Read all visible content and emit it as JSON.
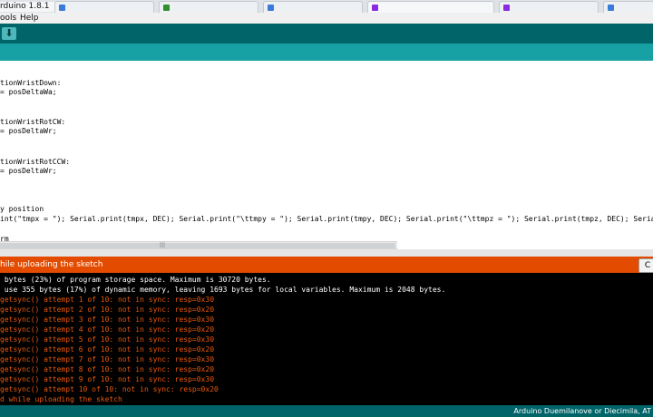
{
  "window": {
    "title": "rduino 1.8.1"
  },
  "menu": [
    "ools",
    "Help"
  ],
  "toolbar": {
    "buttons": [
      {
        "name": "export",
        "glyph": "⬇"
      }
    ]
  },
  "editor": {
    "lines": [
      "tionWristDown:",
      "= posDeltaWa;",
      "",
      "",
      "tionWristRotCW:",
      "= posDeltaWr;",
      "",
      "",
      "tionWristRotCCW:",
      "= posDeltaWr;",
      "",
      "",
      "",
      "y position",
      "int(\"tmpx = \"); Serial.print(tmpx, DEC); Serial.print(\"\\ttmpy = \"); Serial.print(tmpy, DEC); Serial.print(\"\\ttmpz = \"); Serial.print(tmpz, DEC); Serial.print(\"\\ttmp",
      "",
      "rm"
    ]
  },
  "status": {
    "message": "hile uploading the sketch",
    "copy_button": "C"
  },
  "console": {
    "lines": [
      {
        "text": " bytes (23%) of program storage space. Maximum is 30720 bytes.",
        "style": "white"
      },
      {
        "text": " use 355 bytes (17%) of dynamic memory, leaving 1693 bytes for local variables. Maximum is 2048 bytes.",
        "style": "white"
      },
      {
        "text": "getsync() attempt 1 of 10: not in sync: resp=0x30",
        "style": "orange"
      },
      {
        "text": "getsync() attempt 2 of 10: not in sync: resp=0x20",
        "style": "orange"
      },
      {
        "text": "getsync() attempt 3 of 10: not in sync: resp=0x30",
        "style": "orange"
      },
      {
        "text": "getsync() attempt 4 of 10: not in sync: resp=0x20",
        "style": "orange"
      },
      {
        "text": "getsync() attempt 5 of 10: not in sync: resp=0x30",
        "style": "orange"
      },
      {
        "text": "getsync() attempt 6 of 10: not in sync: resp=0x20",
        "style": "orange"
      },
      {
        "text": "getsync() attempt 7 of 10: not in sync: resp=0x30",
        "style": "orange"
      },
      {
        "text": "getsync() attempt 8 of 10: not in sync: resp=0x20",
        "style": "orange"
      },
      {
        "text": "getsync() attempt 9 of 10: not in sync: resp=0x30",
        "style": "orange"
      },
      {
        "text": "getsync() attempt 10 of 10: not in sync: resp=0x20",
        "style": "orange"
      },
      {
        "text": "d while uploading the sketch",
        "style": "orange"
      }
    ]
  },
  "footer": {
    "board": "Arduino Duemilanove or Diecimila, AT"
  },
  "colors": {
    "toolbar": "#006468",
    "tabstrip": "#17a1a5",
    "status_error": "#e34c00",
    "console_bg": "#000000",
    "console_error": "#e8590c"
  }
}
